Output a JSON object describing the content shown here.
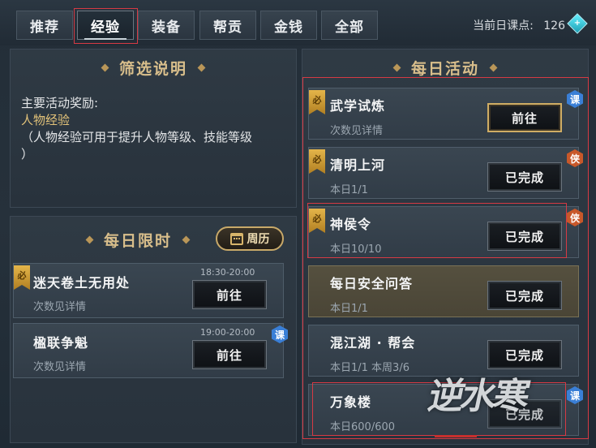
{
  "tabs": [
    "推荐",
    "经验",
    "装备",
    "帮贡",
    "金钱",
    "全部"
  ],
  "active_tab": "经验",
  "course_points": {
    "label": "当前日课点:",
    "value": "126"
  },
  "filter_panel": {
    "title": "筛选说明",
    "line1": "主要活动奖励:",
    "line2": "人物经验",
    "line3": "（人物经验可用于提升人物等级、技能等级",
    "line4": "）"
  },
  "timed_panel": {
    "title": "每日限时",
    "calendar_label": "周历",
    "items": [
      {
        "name": "迷天卷土无用处",
        "time": "18:30-20:00",
        "sub": "次数见详情",
        "button": "前往",
        "must": "必",
        "badge": ""
      },
      {
        "name": "楹联争魁",
        "time": "19:00-20:00",
        "sub": "次数见详情",
        "button": "前往",
        "must": "",
        "badge": "课"
      }
    ]
  },
  "daily_panel": {
    "title": "每日活动",
    "items": [
      {
        "name": "武学试炼",
        "sub": "次数见详情",
        "button": "前往",
        "must": "必",
        "badge": "课"
      },
      {
        "name": "清明上河",
        "sub": "本日1/1",
        "button": "已完成",
        "must": "必",
        "badge": "侠"
      },
      {
        "name": "神侯令",
        "sub": "本日10/10",
        "button": "已完成",
        "must": "必",
        "badge": "侠"
      },
      {
        "name": "每日安全问答",
        "sub": "本日1/1",
        "button": "已完成",
        "must": "",
        "badge": ""
      },
      {
        "name": "混江湖 · 帮会",
        "sub": "本日1/1  本周3/6",
        "button": "已完成",
        "must": "",
        "badge": ""
      },
      {
        "name": "万象楼",
        "sub": "本日600/600",
        "button": "已完成",
        "must": "",
        "badge": "课"
      }
    ]
  },
  "watermark": "逆水寒",
  "colors": {
    "accent_gold": "#d8be8b",
    "highlight_red": "#d63a44",
    "badge_blue": "#3a7fd6",
    "badge_orange": "#c8582a"
  }
}
